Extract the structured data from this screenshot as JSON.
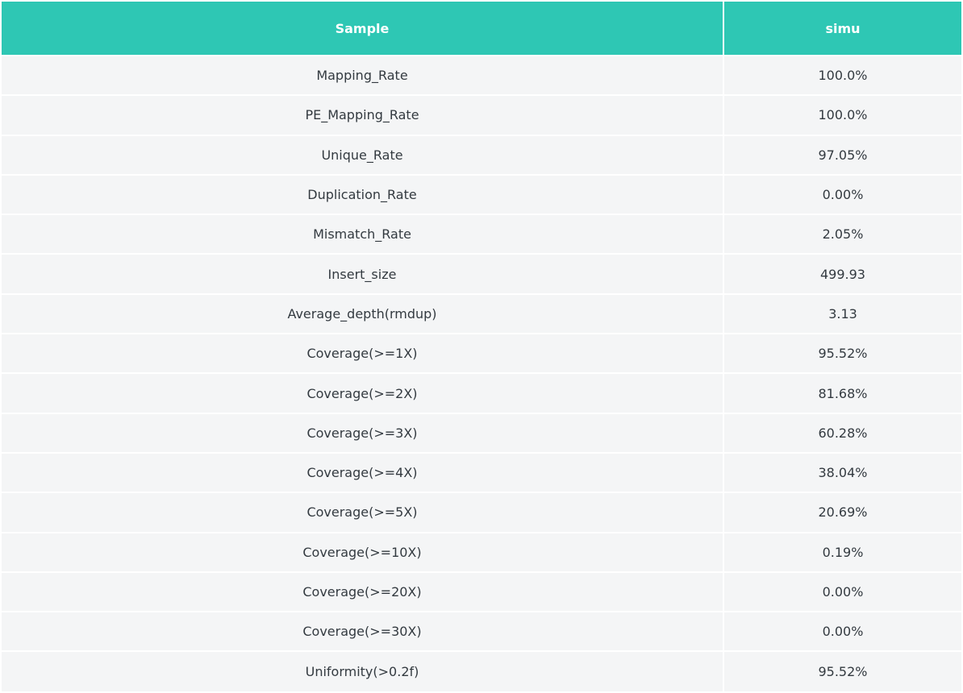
{
  "table": {
    "columns": [
      "Sample",
      "simu"
    ],
    "rows": [
      [
        "Mapping_Rate",
        "100.0%"
      ],
      [
        "PE_Mapping_Rate",
        "100.0%"
      ],
      [
        "Unique_Rate",
        "97.05%"
      ],
      [
        "Duplication_Rate",
        "0.00%"
      ],
      [
        "Mismatch_Rate",
        "2.05%"
      ],
      [
        "Insert_size",
        "499.93"
      ],
      [
        "Average_depth(rmdup)",
        "3.13"
      ],
      [
        "Coverage(>=1X)",
        "95.52%"
      ],
      [
        "Coverage(>=2X)",
        "81.68%"
      ],
      [
        "Coverage(>=3X)",
        "60.28%"
      ],
      [
        "Coverage(>=4X)",
        "38.04%"
      ],
      [
        "Coverage(>=5X)",
        "20.69%"
      ],
      [
        "Coverage(>=10X)",
        "0.19%"
      ],
      [
        "Coverage(>=20X)",
        "0.00%"
      ],
      [
        "Coverage(>=30X)",
        "0.00%"
      ],
      [
        "Uniformity(>0.2f)",
        "95.52%"
      ]
    ]
  },
  "colors": {
    "header_bg": "#2ec7b4",
    "row_bg": "#f4f5f6",
    "text": "#333a40"
  }
}
